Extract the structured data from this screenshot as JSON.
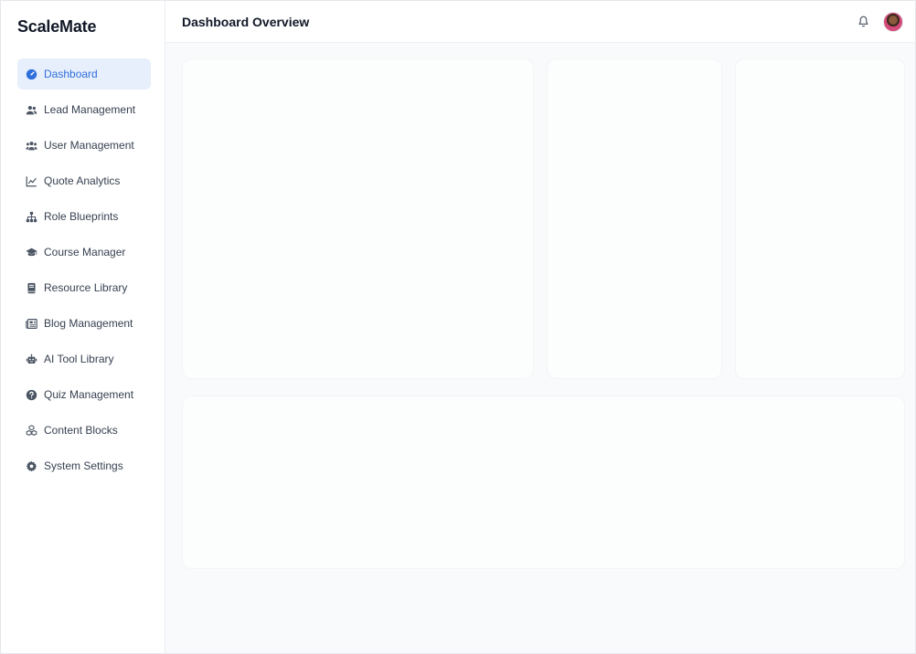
{
  "app": {
    "brand": "ScaleMate"
  },
  "header": {
    "title": "Dashboard Overview"
  },
  "sidebar": {
    "items": [
      {
        "label": "Dashboard",
        "icon": "dashboard-icon",
        "active": true
      },
      {
        "label": "Lead Management",
        "icon": "users-icon",
        "active": false
      },
      {
        "label": "User Management",
        "icon": "user-group-icon",
        "active": false
      },
      {
        "label": "Quote Analytics",
        "icon": "line-chart-icon",
        "active": false
      },
      {
        "label": "Role Blueprints",
        "icon": "sitemap-icon",
        "active": false
      },
      {
        "label": "Course Manager",
        "icon": "graduation-cap-icon",
        "active": false
      },
      {
        "label": "Resource Library",
        "icon": "book-icon",
        "active": false
      },
      {
        "label": "Blog Management",
        "icon": "newspaper-icon",
        "active": false
      },
      {
        "label": "AI Tool Library",
        "icon": "robot-icon",
        "active": false
      },
      {
        "label": "Quiz Management",
        "icon": "question-circle-icon",
        "active": false
      },
      {
        "label": "Content Blocks",
        "icon": "cubes-icon",
        "active": false
      },
      {
        "label": "System Settings",
        "icon": "gear-icon",
        "active": false
      }
    ]
  },
  "colors": {
    "accent": "#2f6fdc",
    "active_bg": "#e8effc",
    "content_bg": "#f9fafb"
  }
}
